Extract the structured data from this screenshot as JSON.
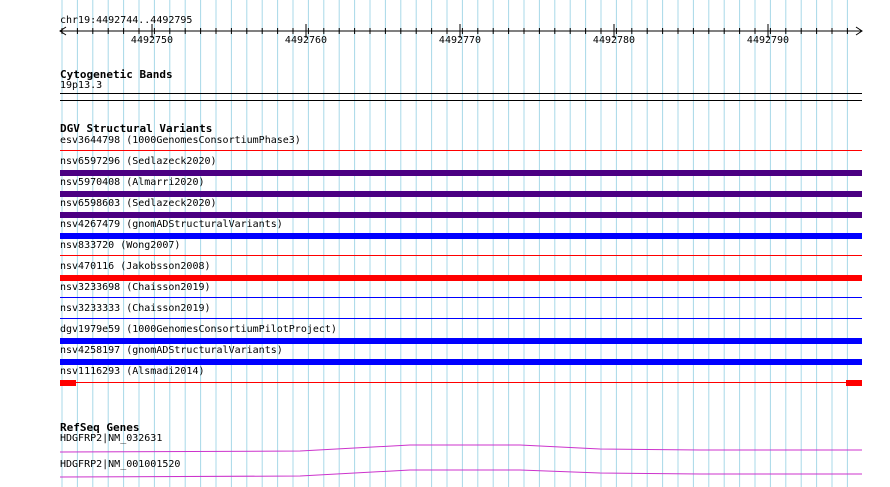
{
  "ruler": {
    "position_label": "chr19:4492744..4492795",
    "ticks": [
      "4492750",
      "4492760",
      "4492770",
      "4492780",
      "4492790"
    ]
  },
  "cytoband": {
    "title": "Cytogenetic Bands",
    "band": "19p13.3"
  },
  "dgv": {
    "title": "DGV Structural Variants",
    "items": [
      {
        "label": "esv3644798 (1000GenomesConsortiumPhase3)",
        "color": "#ff0000",
        "style": "thin"
      },
      {
        "label": "nsv6597296 (Sedlazeck2020)",
        "color": "#4b0082",
        "style": "thick"
      },
      {
        "label": "nsv5970408 (Almarri2020)",
        "color": "#4b0082",
        "style": "thick"
      },
      {
        "label": "nsv6598603 (Sedlazeck2020)",
        "color": "#4b0082",
        "style": "thick"
      },
      {
        "label": "nsv4267479 (gnomADStructuralVariants)",
        "color": "#0000ff",
        "style": "thick"
      },
      {
        "label": "nsv833720 (Wong2007)",
        "color": "#ff0000",
        "style": "thin"
      },
      {
        "label": "nsv470116 (Jakobsson2008)",
        "color": "#ff0000",
        "style": "thick"
      },
      {
        "label": "nsv3233698 (Chaisson2019)",
        "color": "#0000ff",
        "style": "thin"
      },
      {
        "label": "nsv3233333 (Chaisson2019)",
        "color": "#0000ff",
        "style": "thin"
      },
      {
        "label": "dgv1979e59 (1000GenomesConsortiumPilotProject)",
        "color": "#0000ff",
        "style": "thick"
      },
      {
        "label": "nsv4258197 (gnomADStructuralVariants)",
        "color": "#0000ff",
        "style": "thick"
      },
      {
        "label": "nsv1116293 (Alsmadi2014)",
        "color": "#ff0000",
        "style": "ends"
      }
    ]
  },
  "refseq": {
    "title": "RefSeq Genes",
    "genes": [
      {
        "label": "HDGFRP2|NM_032631",
        "color": "#cc33cc"
      },
      {
        "label": "HDGFRP2|NM_001001520",
        "color": "#cc33cc"
      }
    ]
  },
  "colors": {
    "grid": "#a8d8e8",
    "axis": "#000000"
  }
}
